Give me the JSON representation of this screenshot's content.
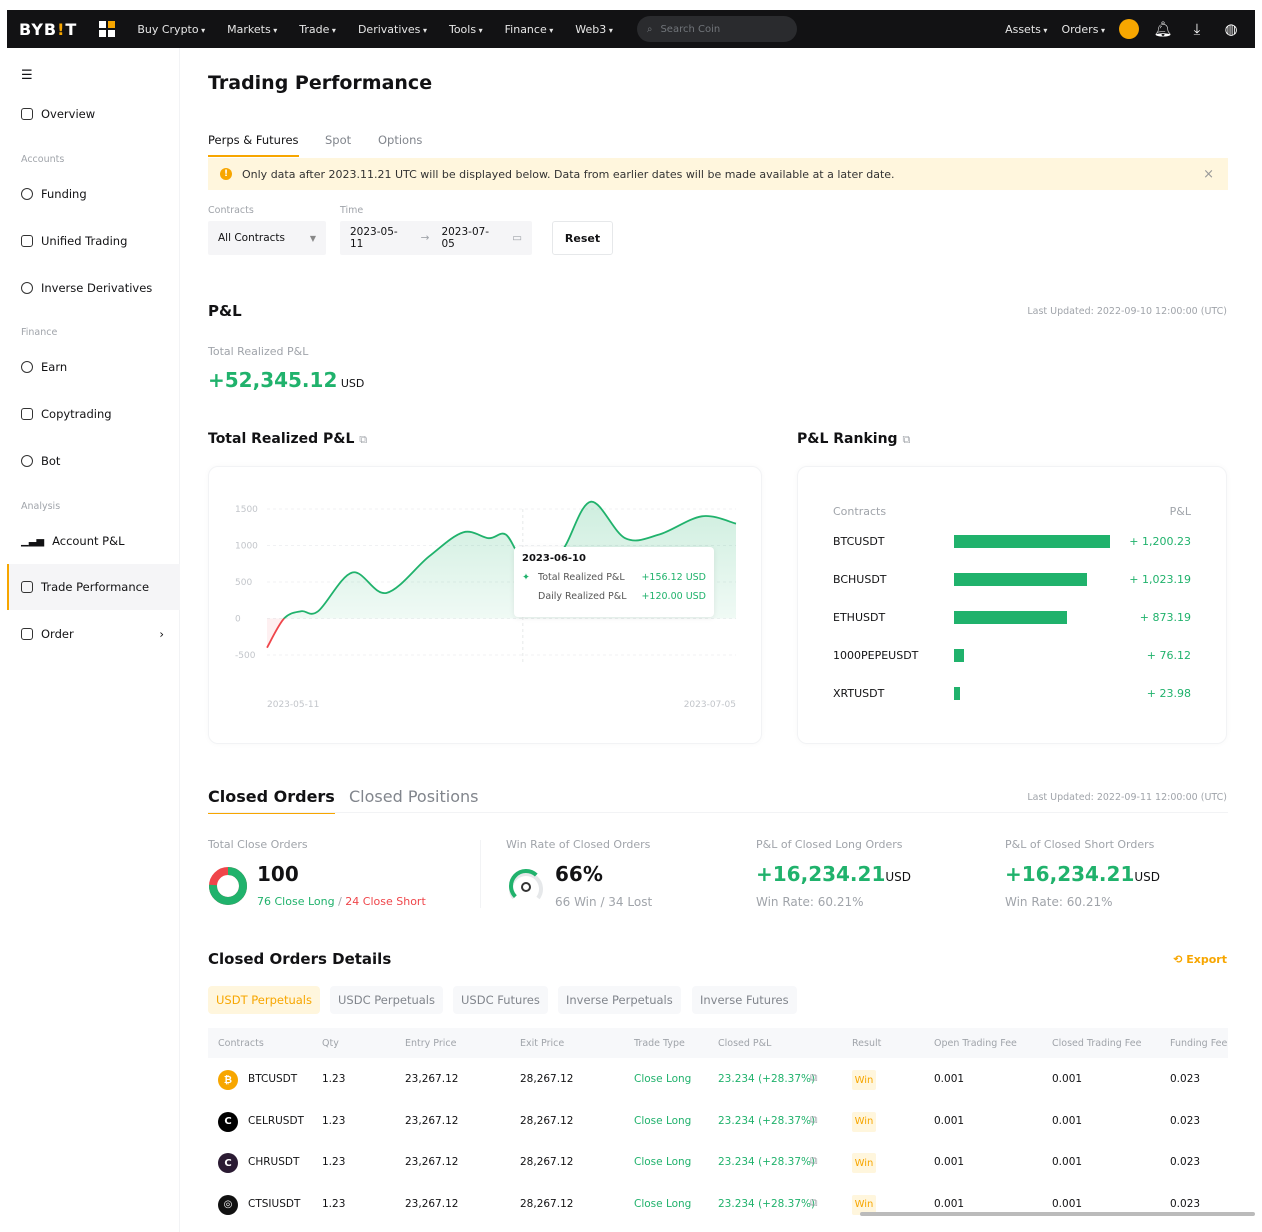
{
  "nav": {
    "logo": "BYB",
    "logo_i": "!",
    "logo_end": "T",
    "items": [
      "Buy Crypto",
      "Markets",
      "Trade",
      "Derivatives",
      "Tools",
      "Finance",
      "Web3"
    ],
    "search_placeholder": "Search Coin",
    "right": [
      "Assets",
      "Orders"
    ],
    "icons": [
      "avatar-icon",
      "bell-icon",
      "download-icon",
      "globe-icon"
    ]
  },
  "sidebar": {
    "overview": "Overview",
    "groups": [
      "Accounts",
      "Finance",
      "Analysis"
    ],
    "items": [
      "Funding",
      "Unified Trading",
      "Inverse Derivatives",
      "Earn",
      "Copytrading",
      "Bot",
      "Account P&L",
      "Trade Performance",
      "Order"
    ],
    "active": "Trade Performance"
  },
  "page": {
    "title": "Trading Performance",
    "tabs": [
      "Perps & Futures",
      "Spot",
      "Options"
    ],
    "banner": "Only data after 2023.11.21 UTC will be displayed below. Data from earlier dates will be made available at a later date."
  },
  "filters": {
    "contracts_label": "Contracts",
    "contracts_value": "All Contracts",
    "time_label": "Time",
    "start": "2023-05-11",
    "arrow": "→",
    "end": "2023-07-05",
    "reset": "Reset"
  },
  "pnl": {
    "title": "P&L",
    "last_updated": "Last Updated: 2022-09-10 12:00:00 (UTC)",
    "total_label": "Total Realized P&L",
    "total_value": "+52,345.12",
    "currency": "USD"
  },
  "chart_data": [
    {
      "type": "area",
      "title": "Total Realized P&L",
      "x_range": [
        "2023-05-11",
        "2023-07-05"
      ],
      "xticks": [
        "2023-05-11",
        "2023-07-05"
      ],
      "yticks": [
        "1500",
        "1000",
        "500",
        "0",
        "-500"
      ],
      "ylim": [
        -500,
        1500
      ],
      "grid": true,
      "colors": {
        "positive": "#20b26c",
        "negative": "#ef454a"
      },
      "x": [
        "2023-05-11",
        "2023-05-13",
        "2023-05-15",
        "2023-05-17",
        "2023-05-21",
        "2023-05-25",
        "2023-05-30",
        "2023-06-03",
        "2023-06-06",
        "2023-06-08",
        "2023-06-10",
        "2023-06-13",
        "2023-06-15",
        "2023-06-18",
        "2023-06-22",
        "2023-06-26",
        "2023-07-01",
        "2023-07-05"
      ],
      "y": [
        -400,
        0,
        100,
        100,
        630,
        350,
        850,
        1180,
        1100,
        1150,
        800,
        650,
        1000,
        1600,
        1100,
        1150,
        1400,
        1300
      ],
      "tooltip": {
        "date": "2023-06-10",
        "rows": [
          {
            "label": "Total Realized P&L",
            "value": "+156.12 USD"
          },
          {
            "label": "Daily Realized P&L",
            "value": "+120.00 USD"
          }
        ]
      }
    },
    {
      "type": "bar",
      "title": "P&L Ranking",
      "orientation": "horizontal",
      "headers": [
        "Contracts",
        "P&L"
      ],
      "categories": [
        "BTCUSDT",
        "BCHUSDT",
        "ETHUSDT",
        "1000PEPEUSDT",
        "XRTUSDT"
      ],
      "values": [
        1200.23,
        1023.19,
        873.19,
        76.12,
        23.98
      ],
      "labels": [
        "+ 1,200.23",
        "+ 1,023.19",
        "+ 873.19",
        "+ 76.12",
        "+ 23.98"
      ],
      "color": "#20b26c"
    }
  ],
  "closed": {
    "tabs": [
      "Closed Orders",
      "Closed Positions"
    ],
    "last_updated": "Last Updated: 2022-09-11 12:00:00 (UTC)",
    "total_label": "Total Close Orders",
    "total": "100",
    "long": "76 Close Long",
    "sep": " / ",
    "short": "24 Close Short",
    "long_frac": 0.76,
    "winrate_label": "Win Rate of Closed Orders",
    "winrate": "66%",
    "winlost": "66 Win / 34 Lost",
    "winrate_frac": 0.66,
    "long_label": "P&L of Closed Long Orders",
    "long_value": "+16,234.21",
    "long_rate": "Win Rate: 60.21%",
    "short_label": "P&L of Closed Short Orders",
    "short_value": "+16,234.21",
    "short_rate": "Win Rate: 60.21%",
    "currency": "USD"
  },
  "details": {
    "title": "Closed Orders Details",
    "export": "Export",
    "tabs": [
      "USDT Perpetuals",
      "USDC Perpetuals",
      "USDC Futures",
      "Inverse Perpetuals",
      "Inverse Futures"
    ],
    "columns": [
      "Contracts",
      "Qty",
      "Entry Price",
      "Exit Price",
      "Trade Type",
      "Closed P&L",
      "Result",
      "Open Trading Fee",
      "Closed Trading Fee",
      "Funding Fee"
    ],
    "rows": [
      {
        "contract": "BTCUSDT",
        "icon": "₿",
        "color": "#f7a600",
        "qty": "1.23",
        "entry": "23,267.12",
        "exit": "28,267.12",
        "type": "Close Long",
        "pnl": "23.234 (+28.37%)",
        "result": "Win",
        "open_fee": "0.001",
        "close_fee": "0.001",
        "funding": "0.023"
      },
      {
        "contract": "CELRUSDT",
        "icon": "C",
        "color": "#000000",
        "qty": "1.23",
        "entry": "23,267.12",
        "exit": "28,267.12",
        "type": "Close Long",
        "pnl": "23.234 (+28.37%)",
        "result": "Win",
        "open_fee": "0.001",
        "close_fee": "0.001",
        "funding": "0.023"
      },
      {
        "contract": "CHRUSDT",
        "icon": "C",
        "color": "#2b1b33",
        "qty": "1.23",
        "entry": "23,267.12",
        "exit": "28,267.12",
        "type": "Close Long",
        "pnl": "23.234 (+28.37%)",
        "result": "Win",
        "open_fee": "0.001",
        "close_fee": "0.001",
        "funding": "0.023"
      },
      {
        "contract": "CTSIUSDT",
        "icon": "◎",
        "color": "#111111",
        "qty": "1.23",
        "entry": "23,267.12",
        "exit": "28,267.12",
        "type": "Close Long",
        "pnl": "23.234 (+28.37%)",
        "result": "Win",
        "open_fee": "0.001",
        "close_fee": "0.001",
        "funding": "0.023"
      }
    ]
  }
}
